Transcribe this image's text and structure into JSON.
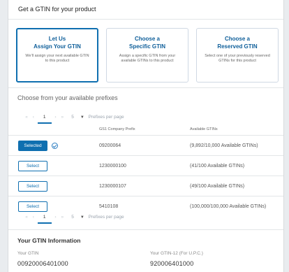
{
  "header": {
    "title": "Get a GTIN for your product"
  },
  "options": [
    {
      "title_line1": "Let Us",
      "title_line2": "Assign Your GTIN",
      "desc": "We'll assign your next available GTIN to this product"
    },
    {
      "title_line1": "Choose a",
      "title_line2": "Specific GTIN",
      "desc": "Assign a specific GTIN from your available GTINs to this product"
    },
    {
      "title_line1": "Choose a",
      "title_line2": "Reserved GTIN",
      "desc": "Select one of your previously reserved GTINs for this product"
    }
  ],
  "prefixes": {
    "section_title": "Choose from your available prefixes",
    "pager": {
      "current_page": "1",
      "page_size": "5",
      "per_page_label": "Prefixes per page"
    },
    "columns": [
      "",
      "GS1 Company Prefix",
      "Available GTINs"
    ],
    "rows": [
      {
        "action": "Selected",
        "prefix": "09200064",
        "available": "(9,892/10,000 Available GTINs)",
        "selected": true
      },
      {
        "action": "Select",
        "prefix": "1230000100",
        "available": "(41/100 Available GTINs)",
        "selected": false
      },
      {
        "action": "Select",
        "prefix": "1230000107",
        "available": "(49/100 Available GTINs)",
        "selected": false
      },
      {
        "action": "Select",
        "prefix": "5410108",
        "available": "(100,000/100,000 Available GTINs)",
        "selected": false
      }
    ]
  },
  "gtin_info": {
    "title": "Your GTIN Information",
    "gtin_label": "Your GTIN",
    "gtin_value": "00920006401000",
    "upc_label": "Your GTIN-12 (For U.P.C.)",
    "upc_value": "920006401000"
  },
  "colors": {
    "accent": "#0f6fb0",
    "title_text": "#0f5f9a"
  }
}
